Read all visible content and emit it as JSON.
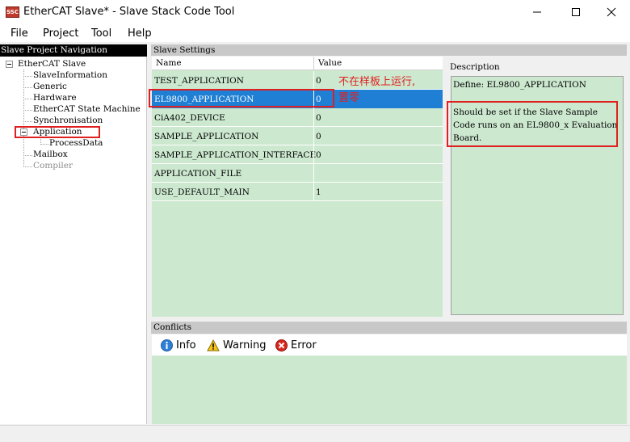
{
  "window": {
    "title": "EtherCAT Slave* - Slave Stack Code Tool",
    "icon_text": "SSC",
    "controls": [
      "minimize-icon",
      "maximize-icon",
      "close-icon"
    ]
  },
  "menu": [
    "File",
    "Project",
    "Tool",
    "Help"
  ],
  "nav": {
    "header": "Slave Project Navigation",
    "tree": [
      {
        "label": "EtherCAT Slave",
        "level": 0,
        "expanded": true
      },
      {
        "label": "SlaveInformation",
        "level": 1
      },
      {
        "label": "Generic",
        "level": 1
      },
      {
        "label": "Hardware",
        "level": 1
      },
      {
        "label": "EtherCAT State Machine",
        "level": 1
      },
      {
        "label": "Synchronisation",
        "level": 1
      },
      {
        "label": "Application",
        "level": 1,
        "expanded": true,
        "selected": true
      },
      {
        "label": "ProcessData",
        "level": 2
      },
      {
        "label": "Mailbox",
        "level": 1
      },
      {
        "label": "Compiler",
        "level": 1,
        "disabled": true
      }
    ]
  },
  "settings": {
    "header": "Slave Settings",
    "columns": {
      "name": "Name",
      "value": "Value"
    },
    "rows": [
      {
        "name": "TEST_APPLICATION",
        "value": "0"
      },
      {
        "name": "EL9800_APPLICATION",
        "value": "0",
        "selected": true
      },
      {
        "name": "CiA402_DEVICE",
        "value": "0"
      },
      {
        "name": "SAMPLE_APPLICATION",
        "value": "0"
      },
      {
        "name": "SAMPLE_APPLICATION_INTERFACE",
        "value": "0"
      },
      {
        "name": "APPLICATION_FILE",
        "value": ""
      },
      {
        "name": "USE_DEFAULT_MAIN",
        "value": "1"
      }
    ]
  },
  "description": {
    "label": "Description",
    "define": "Define: EL9800_APPLICATION",
    "text": "Should be set if the Slave Sample Code runs on an EL9800_x Evaluation Board."
  },
  "annotation": {
    "line1": "不在样板上运行,",
    "line2": "置零",
    "color": "#e02020"
  },
  "conflicts": {
    "header": "Conflicts",
    "buttons": [
      {
        "label": "Info",
        "icon": "info-icon"
      },
      {
        "label": "Warning",
        "icon": "warning-icon"
      },
      {
        "label": "Error",
        "icon": "error-icon"
      }
    ]
  },
  "colors": {
    "grid_bg": "#cce8cf",
    "selection": "#1e7fd4",
    "highlight_box": "#e02020"
  }
}
